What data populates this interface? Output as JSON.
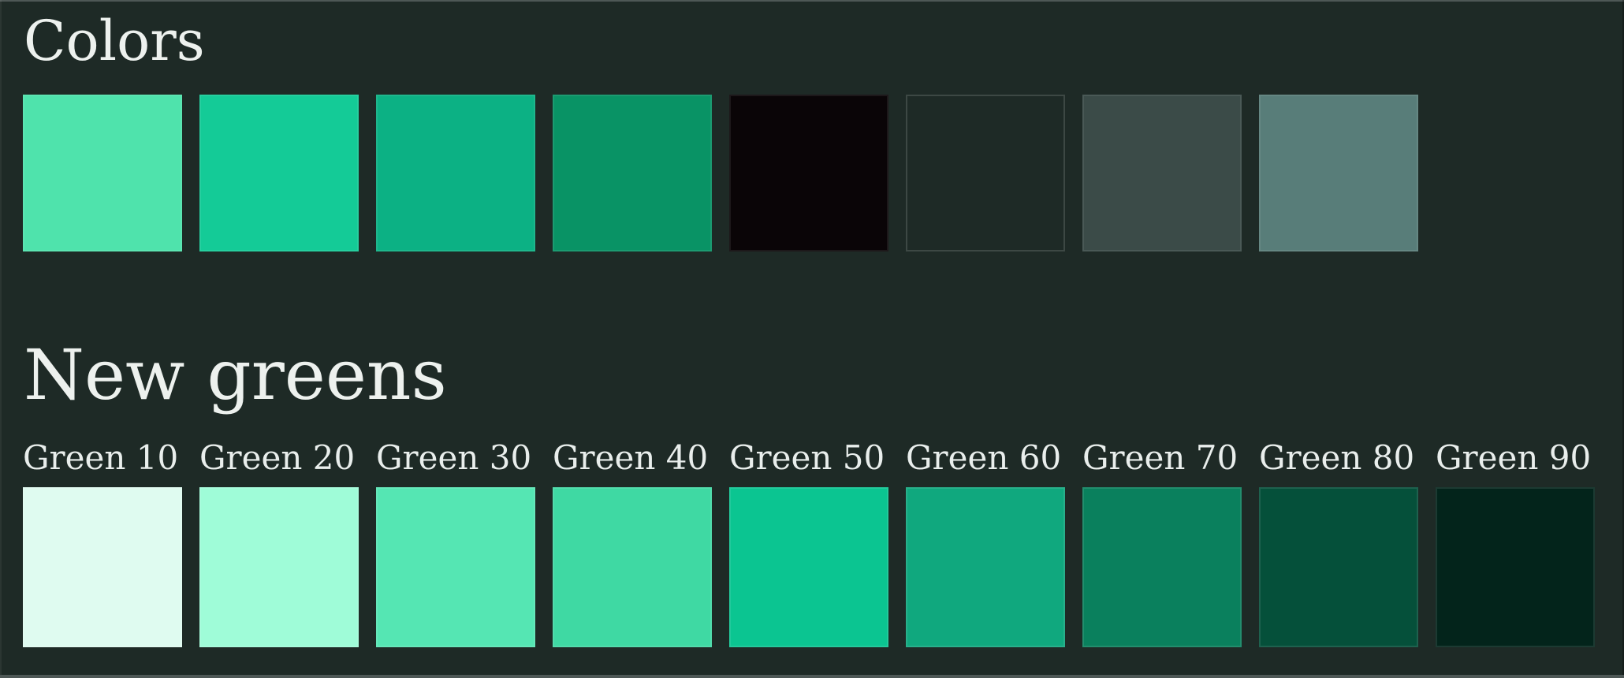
{
  "page": {
    "background": "#1E2A26",
    "edge_color": "#4E5856",
    "heading_color": "#EDF1EE",
    "label_color": "#E9EEEC"
  },
  "colors_section": {
    "title": "Colors",
    "swatches": [
      {
        "hex": "#4FE3AC"
      },
      {
        "hex": "#14CB97"
      },
      {
        "hex": "#0CB184"
      },
      {
        "hex": "#099365"
      },
      {
        "hex": "#0A0507"
      },
      {
        "hex": "",
        "outline": true
      },
      {
        "hex": "#3B4B48"
      },
      {
        "hex": "#587D79"
      }
    ]
  },
  "new_greens_section": {
    "title": "New greens",
    "swatches": [
      {
        "label": "Green 10",
        "hex": "#DFFBF0"
      },
      {
        "label": "Green 20",
        "hex": "#9FFCD8"
      },
      {
        "label": "Green 30",
        "hex": "#55E6B3"
      },
      {
        "label": "Green 40",
        "hex": "#3FD9A3"
      },
      {
        "label": "Green 50",
        "hex": "#0BC591"
      },
      {
        "label": "Green 60",
        "hex": "#10A87E"
      },
      {
        "label": "Green 70",
        "hex": "#0A805D"
      },
      {
        "label": "Green 80",
        "hex": "#05503A"
      },
      {
        "label": "Green 90",
        "hex": "#03241B"
      }
    ]
  }
}
